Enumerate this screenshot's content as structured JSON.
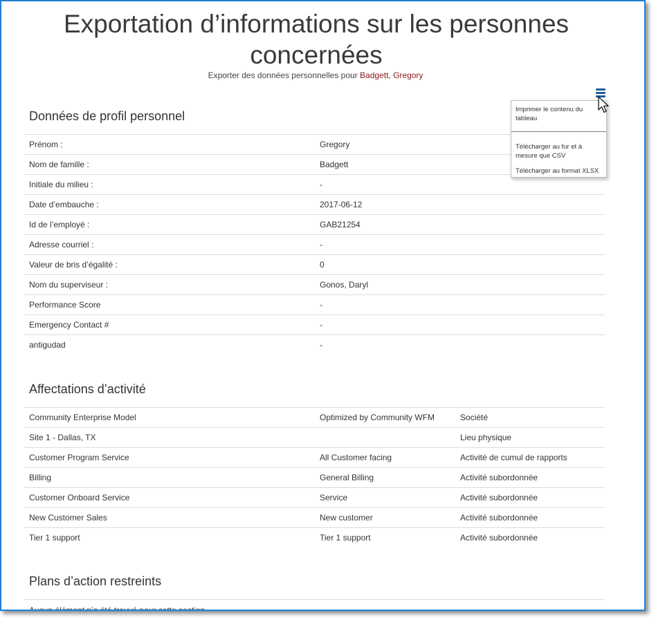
{
  "header": {
    "title": "Exportation d’informations sur les personnes concernées",
    "subtitle_prefix": "Exporter des données personnelles pour ",
    "subtitle_person": "Badgett, Gregory"
  },
  "menu": {
    "icon": "hamburger-menu-icon",
    "items": [
      "Imprimer le contenu du tableau",
      "Télécharger au fur et à mesure que CSV",
      "Télécharger au format XLSX"
    ]
  },
  "profile": {
    "title": "Données de profil personnel",
    "rows": [
      {
        "label": "Prénom :",
        "value": "Gregory"
      },
      {
        "label": "Nom de famille :",
        "value": "Badgett"
      },
      {
        "label": "Initiale du milieu :",
        "value": "-"
      },
      {
        "label": "Date d’embauche :",
        "value": "2017-06-12"
      },
      {
        "label": "Id de l’employé :",
        "value": "GAB21254"
      },
      {
        "label": "Adresse courriel :",
        "value": "-"
      },
      {
        "label": "Valeur de bris d’égalité :",
        "value": "0"
      },
      {
        "label": "Nom du superviseur :",
        "value": "Gonos, Daryl"
      },
      {
        "label": "Performance Score",
        "value": "-"
      },
      {
        "label": "Emergency Contact #",
        "value": "-"
      },
      {
        "label": "antigudad",
        "value": "-"
      }
    ]
  },
  "activities": {
    "title": "Affectations d’activité",
    "rows": [
      {
        "name": "Community Enterprise Model",
        "detail": "Optimized by Community WFM",
        "type": "Société"
      },
      {
        "name": "Site 1 - Dallas, TX",
        "detail": "",
        "type": "Lieu physique"
      },
      {
        "name": "Customer Program Service",
        "detail": "All Customer facing",
        "type": "Activité de cumul de rapports"
      },
      {
        "name": "Billing",
        "detail": "General Billing",
        "type": "Activité subordonnée"
      },
      {
        "name": "Customer Onboard Service",
        "detail": "Service",
        "type": "Activité subordonnée"
      },
      {
        "name": "New Customer Sales",
        "detail": "New customer",
        "type": "Activité subordonnée"
      },
      {
        "name": "Tier 1 support",
        "detail": "Tier 1 support",
        "type": "Activité subordonnée"
      }
    ]
  },
  "restricted": {
    "title": "Plans d’action restreints",
    "empty_message": "Aucun élément n’a été trouvé pour cette section"
  }
}
